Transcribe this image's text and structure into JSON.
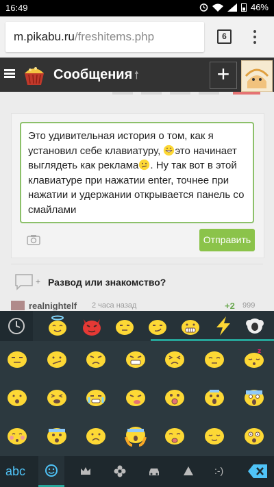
{
  "status_bar": {
    "time": "16:49",
    "battery": "46%"
  },
  "browser": {
    "domain": "m.pikabu.ru",
    "path": "/freshitems.php",
    "tab_count": "6"
  },
  "site_header": {
    "title": "Сообщения"
  },
  "composer": {
    "text_part1": "Это удивительная история о том, как я установил себе клавиатуру, ",
    "text_part2": "это начинает выглядеть как реклама",
    "text_part3": ". Ну так вот в этой клавиатуре при нажатии enter, точнее при нажатии и удержании открывается панель со смайлами",
    "send_label": "Отправить"
  },
  "post": {
    "title": "Развод или знакомство?",
    "plus": "+",
    "author": "realnightelf",
    "time": "2 часа назад",
    "rating": "+2",
    "rating_extra": "999"
  },
  "keyboard": {
    "abc_label": "abc",
    "emoticon_label": ":-)",
    "accent": "#26a69a",
    "emoji_yellow": "#fdd835"
  }
}
